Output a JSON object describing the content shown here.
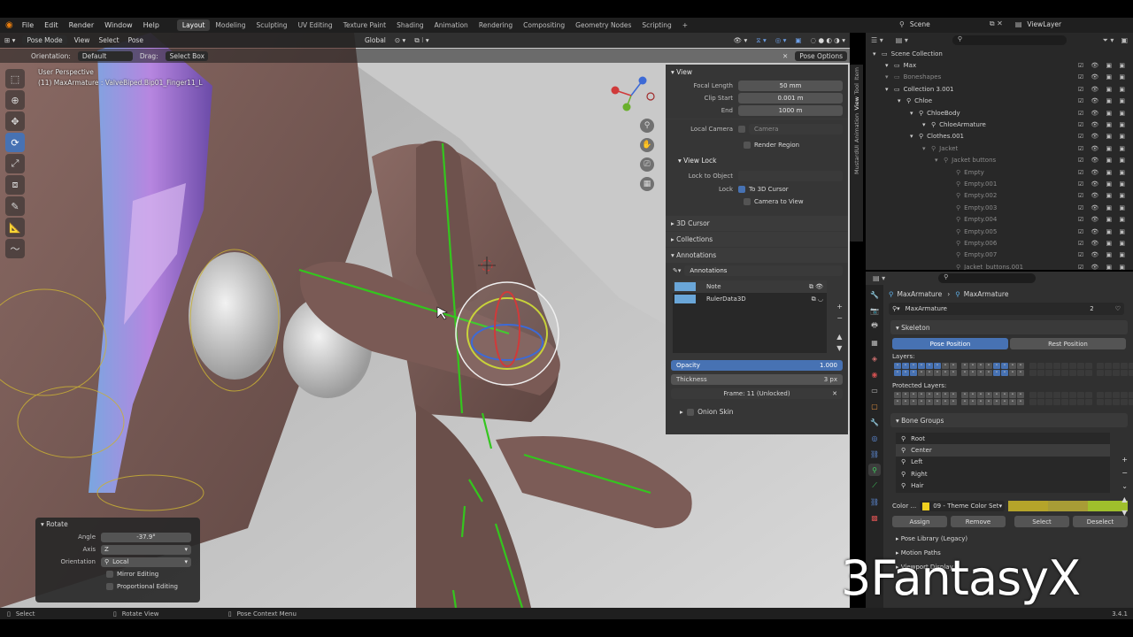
{
  "menu": {
    "items": [
      "File",
      "Edit",
      "Render",
      "Window",
      "Help"
    ],
    "workspaces": [
      "Layout",
      "Modeling",
      "Sculpting",
      "UV Editing",
      "Texture Paint",
      "Shading",
      "Animation",
      "Rendering",
      "Compositing",
      "Geometry Nodes",
      "Scripting"
    ],
    "active_workspace": "Layout",
    "add_tab": "+",
    "scene_label": "Scene",
    "viewlayer_label": "ViewLayer"
  },
  "viewport_header": {
    "mode": "Pose Mode",
    "view": "View",
    "select": "Select",
    "pose": "Pose",
    "orientation": "Global",
    "orientation_label": "Orientation:",
    "orientation_value": "Default",
    "drag_label": "Drag:",
    "drag_value": "Select Box",
    "pose_options": "Pose Options"
  },
  "viewport": {
    "perspective": "User Perspective",
    "active_object": "(11) MaxArmature : ValveBiped.Bip01_Finger11_L"
  },
  "npanel": {
    "view_header": "View",
    "focal_length_label": "Focal Length",
    "focal_length": "50 mm",
    "clip_start_label": "Clip Start",
    "clip_start": "0.001 m",
    "end_label": "End",
    "end": "1000 m",
    "local_camera_label": "Local Camera",
    "camera_placeholder": "Camera",
    "render_region": "Render Region",
    "view_lock_header": "View Lock",
    "lock_to_object_label": "Lock to Object",
    "lock_label": "Lock",
    "to_3d_cursor": "To 3D Cursor",
    "camera_to_view": "Camera to View",
    "cursor_3d": "3D Cursor",
    "collections": "Collections",
    "annotations_header": "Annotations",
    "annotations_datablock": "Annotations",
    "layers": [
      "Note",
      "RulerData3D"
    ],
    "opacity_label": "Opacity",
    "opacity": "1.000",
    "thickness_label": "Thickness",
    "thickness": "3 px",
    "frame": "Frame: 11 (Unlocked)",
    "onion_skin": "Onion Skin",
    "tabs": [
      "Item",
      "Tool",
      "View",
      "Animation",
      "MustardUI"
    ]
  },
  "outliner": {
    "rows": [
      {
        "label": "Scene Collection",
        "indent": 0
      },
      {
        "label": "Max",
        "indent": 1
      },
      {
        "label": "Boneshapes",
        "indent": 1,
        "dim": true
      },
      {
        "label": "Collection 3.001",
        "indent": 1
      },
      {
        "label": "Chloe",
        "indent": 2
      },
      {
        "label": "ChloeBody",
        "indent": 3
      },
      {
        "label": "ChloeArmature",
        "indent": 4
      },
      {
        "label": "Clothes.001",
        "indent": 3
      },
      {
        "label": "Jacket",
        "indent": 4,
        "dim": true
      },
      {
        "label": "Jacket buttons",
        "indent": 5,
        "dim": true
      },
      {
        "label": "Empty",
        "indent": 6,
        "dim": true
      },
      {
        "label": "Empty.001",
        "indent": 6,
        "dim": true
      },
      {
        "label": "Empty.002",
        "indent": 6,
        "dim": true
      },
      {
        "label": "Empty.003",
        "indent": 6,
        "dim": true
      },
      {
        "label": "Empty.004",
        "indent": 6,
        "dim": true
      },
      {
        "label": "Empty.005",
        "indent": 6,
        "dim": true
      },
      {
        "label": "Empty.006",
        "indent": 6,
        "dim": true
      },
      {
        "label": "Empty.007",
        "indent": 6,
        "dim": true
      },
      {
        "label": "Jacket_buttons.001",
        "indent": 6,
        "dim": true
      }
    ]
  },
  "properties": {
    "breadcrumb_1": "MaxArmature",
    "breadcrumb_2": "MaxArmature",
    "data_name": "MaxArmature",
    "users": "2",
    "skeleton_header": "Skeleton",
    "pose_position": "Pose Position",
    "rest_position": "Rest Position",
    "layers_label": "Layers:",
    "protected_layers_label": "Protected Layers:",
    "bone_groups_header": "Bone Groups",
    "bone_groups": [
      "Root",
      "Center",
      "Left",
      "Right",
      "Hair"
    ],
    "selected_bone_group": "Center",
    "color_label": "Color ...",
    "color_set": "09 - Theme Color Set",
    "assign": "Assign",
    "remove": "Remove",
    "select": "Select",
    "deselect": "Deselect",
    "pose_library": "Pose Library (Legacy)",
    "motion_paths": "Motion Paths",
    "viewport_display": "Viewport Display",
    "swatch_colors": [
      "#b5a42a",
      "#a89c36",
      "#9fbf2c"
    ]
  },
  "redo_panel": {
    "title": "Rotate",
    "angle_label": "Angle",
    "angle": "-37.9°",
    "axis_label": "Axis",
    "axis": "Z",
    "orientation_label": "Orientation",
    "orientation": "Local",
    "mirror_editing": "Mirror Editing",
    "proportional_editing": "Proportional Editing"
  },
  "statusbar": {
    "select": "Select",
    "rotate_view": "Rotate View",
    "context_menu": "Pose Context Menu",
    "version": "3.4.1"
  },
  "watermark": "3FantasyX",
  "colors": {
    "accent": "#4772b3",
    "bone_green": "#34c61e",
    "skin": "#7a5a55"
  }
}
